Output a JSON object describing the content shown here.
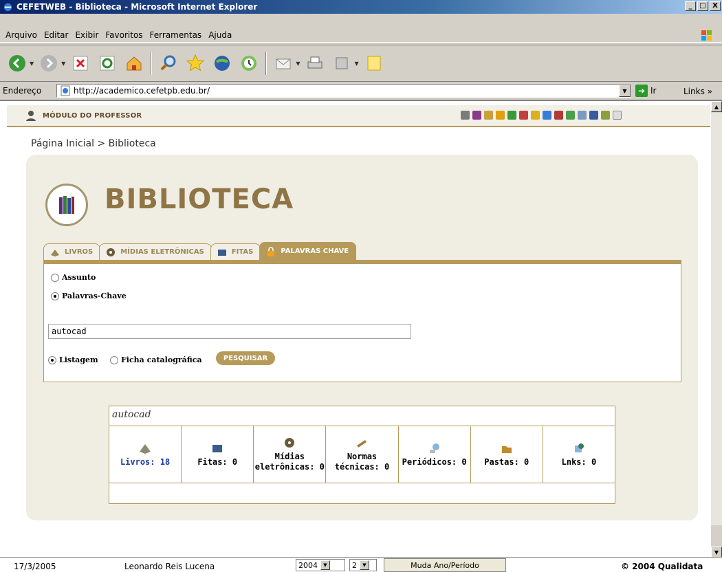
{
  "window": {
    "title": "CEFETWEB - Biblioteca - Microsoft Internet Explorer",
    "minimize": "_",
    "maximize": "□",
    "close": "X"
  },
  "menu": [
    "Arquivo",
    "Editar",
    "Exibir",
    "Favoritos",
    "Ferramentas",
    "Ajuda"
  ],
  "address": {
    "label": "Endereço",
    "url": "http://academico.cefetpb.edu.br/",
    "go_label": "Ir",
    "links_label": "Links"
  },
  "module": {
    "label": "MÓDULO DO PROFESSOR"
  },
  "breadcrumb": "Página Inicial > Biblioteca",
  "page_title": "BIBLIOTECA",
  "tabs": [
    {
      "label": "LIVROS"
    },
    {
      "label": "MÍDIAS ELETRÔNICAS"
    },
    {
      "label": "FITAS"
    },
    {
      "label": "PALAVRAS CHAVE",
      "active": true
    }
  ],
  "search": {
    "option_assunto": "Assunto",
    "option_palavras": "Palavras-Chave",
    "keyword": "autocad",
    "option_listagem": "Listagem",
    "option_ficha": "Ficha catalográfica",
    "button": "PESQUISAR"
  },
  "results": {
    "query": "autocad",
    "cells": [
      {
        "label": "Livros: 18",
        "icon": "book-icon"
      },
      {
        "label": "Fitas: 0",
        "icon": "tape-icon"
      },
      {
        "label": "Mídias eletrônicas: 0",
        "icon": "cd-icon"
      },
      {
        "label": "Normas técnicas: 0",
        "icon": "norms-icon"
      },
      {
        "label": "Periódicos: 0",
        "icon": "periodicals-icon"
      },
      {
        "label": "Pastas: 0",
        "icon": "folders-icon"
      },
      {
        "label": "Lnks: 0",
        "icon": "links-icon"
      }
    ]
  },
  "status": {
    "date": "17/3/2005",
    "user": "Leonardo Reis Lucena",
    "year": "2004",
    "period": "2",
    "change_button": "Muda Ano/Período",
    "copyright": "© 2004 Qualidata"
  }
}
